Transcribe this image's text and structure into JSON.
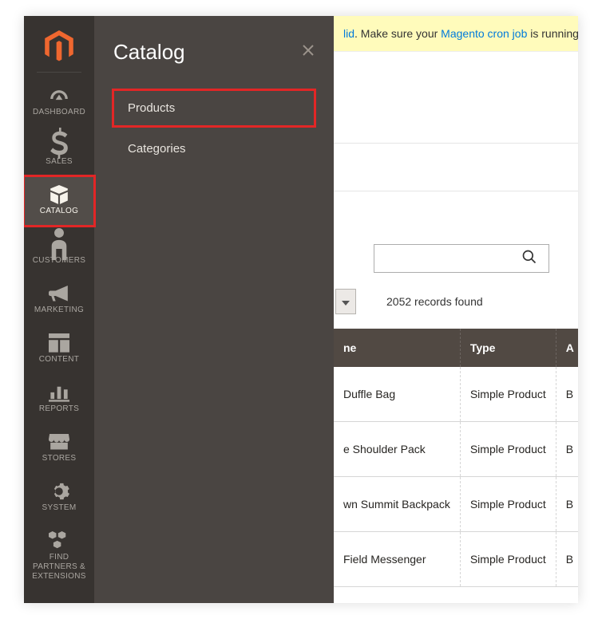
{
  "sidebar": {
    "items": [
      {
        "label": "DASHBOARD",
        "icon": "dashboard-icon"
      },
      {
        "label": "SALES",
        "icon": "dollar-icon"
      },
      {
        "label": "CATALOG",
        "icon": "box-icon"
      },
      {
        "label": "CUSTOMERS",
        "icon": "person-icon"
      },
      {
        "label": "MARKETING",
        "icon": "megaphone-icon"
      },
      {
        "label": "CONTENT",
        "icon": "layout-icon"
      },
      {
        "label": "REPORTS",
        "icon": "bars-icon"
      },
      {
        "label": "STORES",
        "icon": "storefront-icon"
      },
      {
        "label": "SYSTEM",
        "icon": "gear-icon"
      },
      {
        "label": "FIND PARTNERS & EXTENSIONS",
        "icon": "blocks-icon"
      }
    ]
  },
  "flyout": {
    "title": "Catalog",
    "items": [
      {
        "label": "Products"
      },
      {
        "label": "Categories"
      }
    ]
  },
  "notice": {
    "fragment_lid": "lid",
    "text_middle": ". Make sure your ",
    "link_text": "Magento cron job",
    "text_tail": " is running."
  },
  "toolbar": {
    "records_text": "2052 records found"
  },
  "table": {
    "headers": {
      "name": "ne",
      "type": "Type",
      "a": "A"
    },
    "rows": [
      {
        "name": "Duffle Bag",
        "type": "Simple Product",
        "a": "B"
      },
      {
        "name": "e Shoulder Pack",
        "type": "Simple Product",
        "a": "B"
      },
      {
        "name": "wn Summit Backpack",
        "type": "Simple Product",
        "a": "B"
      },
      {
        "name": "Field Messenger",
        "type": "Simple Product",
        "a": "B"
      }
    ]
  },
  "colors": {
    "accent_orange": "#ef672f",
    "highlight_red": "#e22626",
    "sidebar_bg": "#373330",
    "flyout_bg": "#4a4542",
    "link_blue": "#007bdb",
    "notice_bg": "#fffbbb",
    "table_header_bg": "#514943"
  }
}
